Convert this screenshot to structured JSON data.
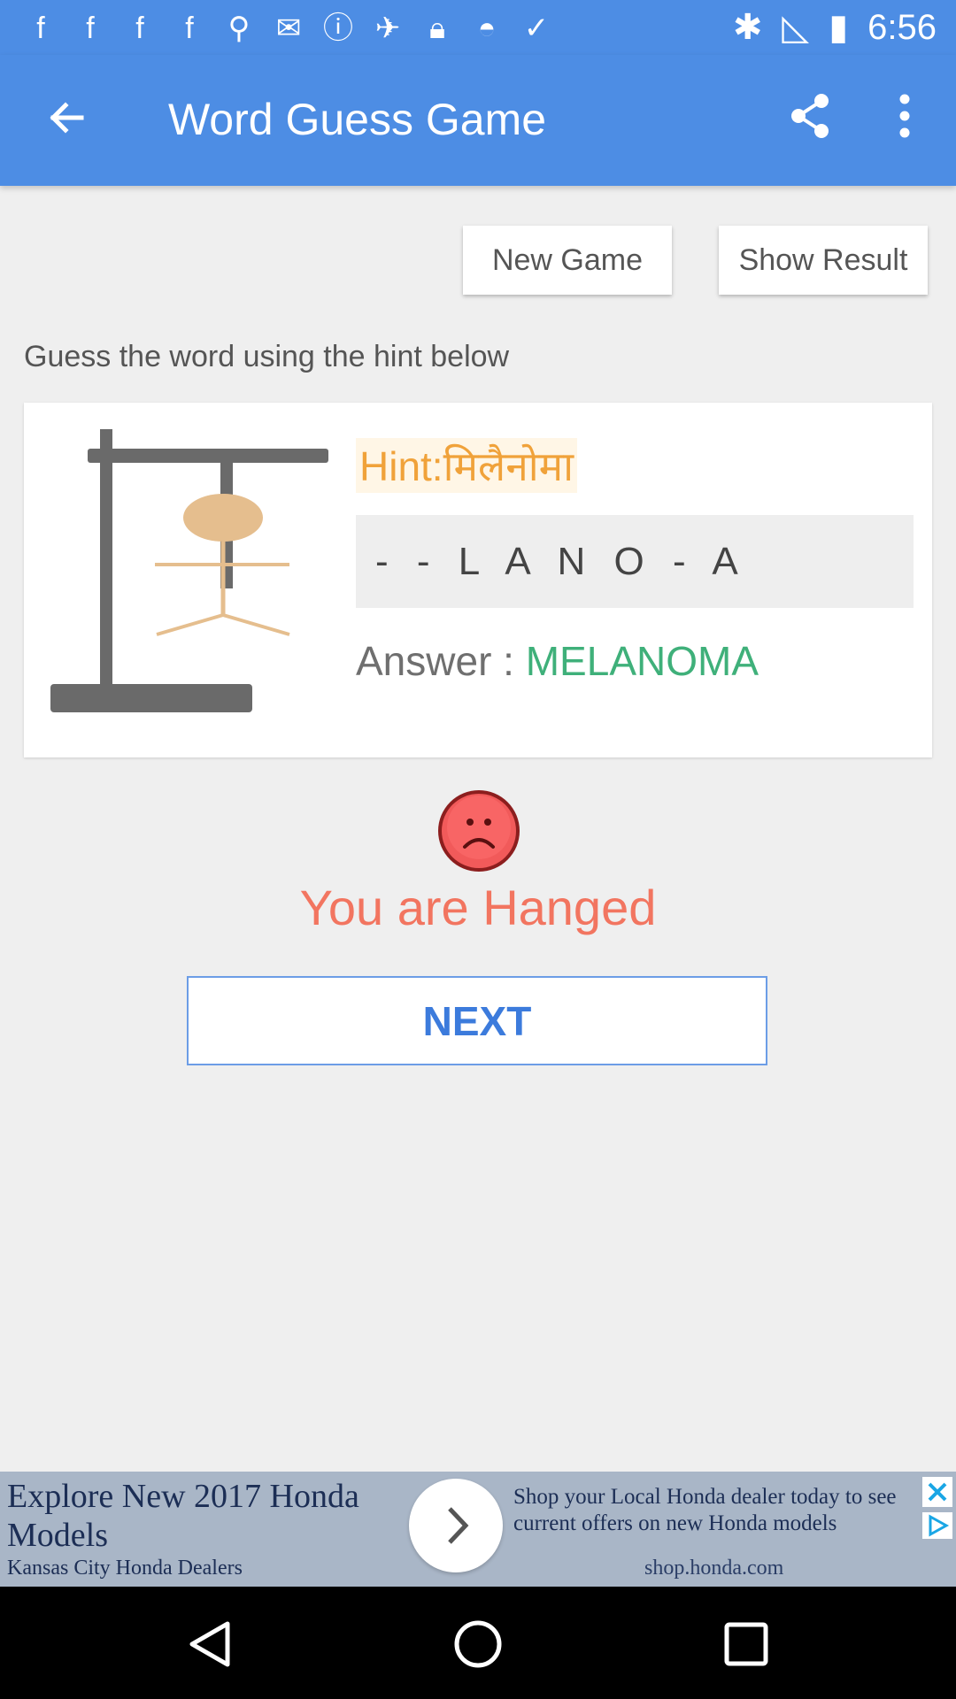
{
  "status_bar": {
    "time": "6:56",
    "left_icons": [
      "fb-icon",
      "fb-icon",
      "fb-icon",
      "fb-icon",
      "notification-icon",
      "mail-icon",
      "info-icon",
      "satellite-icon",
      "lock-icon",
      "android-icon",
      "check-tray-icon"
    ],
    "right_icons": [
      "bluetooth-icon",
      "no-sim-icon",
      "battery-icon"
    ]
  },
  "app_bar": {
    "title": "Word Guess Game",
    "background": "#4d8de4"
  },
  "actions": {
    "new_game": "New Game",
    "show_result": "Show Result"
  },
  "instructions": "Guess the word using the hint below",
  "game": {
    "hint_label": "Hint:",
    "hint_value": "मिलैनोमा",
    "masked_word": "- - L A N O - A",
    "answer_label": "Answer : ",
    "answer_value": "MELANOMA"
  },
  "result": {
    "message": "You are Hanged",
    "color": "#f27560"
  },
  "next_button": "NEXT",
  "ad": {
    "headline": "Explore New 2017 Honda Models",
    "advertiser": "Kansas City Honda Dealers",
    "body": "Shop your Local Honda dealer today to see current offers on new Honda models",
    "domain": "shop.honda.com"
  }
}
